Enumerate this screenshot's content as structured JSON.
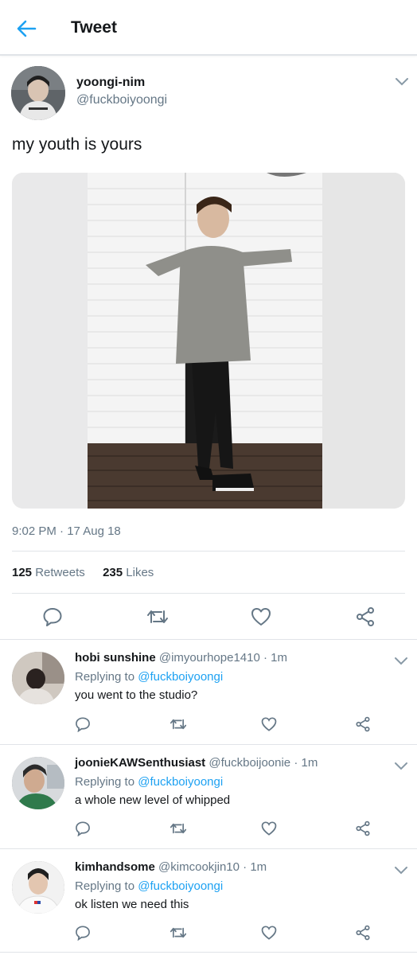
{
  "header": {
    "title": "Tweet",
    "back_icon": "back-arrow-icon"
  },
  "tweet": {
    "author_name": "yoongi-nim",
    "author_handle": "@fuckboiyoongi",
    "text": "my youth is yours",
    "timestamp": "9:02 PM · 17 Aug 18",
    "retweets_count": "125",
    "retweets_label": "Retweets",
    "likes_count": "235",
    "likes_label": "Likes"
  },
  "replies": [
    {
      "name": "hobi sunshine",
      "handle": "@imyourhope1410",
      "time": "· 1m",
      "replying_label": "Replying to",
      "replying_handle": "@fuckboiyoongi",
      "text": "you went to the studio?"
    },
    {
      "name": "joonieKAWSenthusiast",
      "handle": "@fuckboijoonie",
      "time": "· 1m",
      "replying_label": "Replying to",
      "replying_handle": "@fuckboiyoongi",
      "text": "a whole new level of whipped"
    },
    {
      "name": "kimhandsome",
      "handle": "@kimcookjin10",
      "time": "· 1m",
      "replying_label": "Replying to",
      "replying_handle": "@fuckboiyoongi",
      "text": "ok listen we need this"
    }
  ],
  "colors": {
    "accent": "#1da1f2",
    "text": "#14171a",
    "secondary": "#657786",
    "divider": "#e1e4e8"
  }
}
